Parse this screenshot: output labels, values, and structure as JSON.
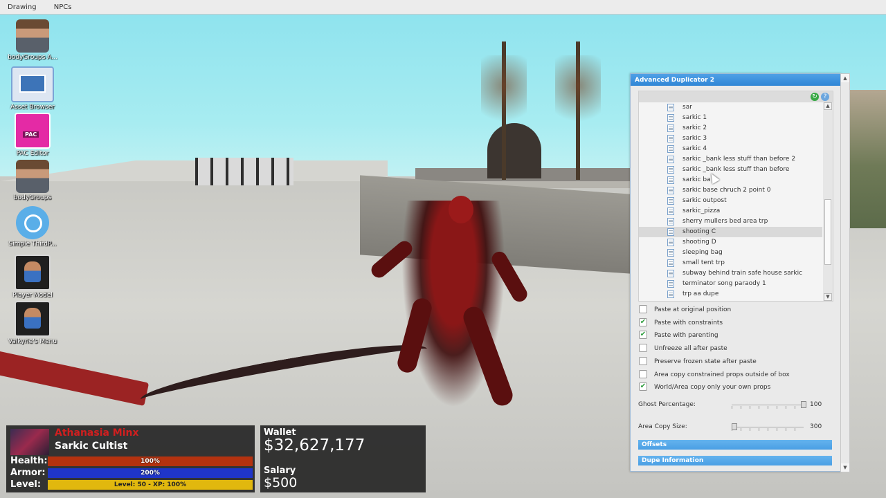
{
  "menu": [
    "Drawing",
    "NPCs"
  ],
  "desktop_icons": [
    {
      "label": "bodyGroups A...",
      "icon": "face-icon"
    },
    {
      "label": "Asset Browser",
      "icon": "asset-browser-icon"
    },
    {
      "label": "PAC Editor",
      "icon": "pac-icon"
    },
    {
      "label": "bodyGroups",
      "icon": "face-icon"
    },
    {
      "label": "Simple ThirdP...",
      "icon": "magnifier-icon"
    },
    {
      "label": "Player Model",
      "icon": "player-model-icon"
    },
    {
      "label": "Valkyrie's Menu",
      "icon": "player-model-icon"
    }
  ],
  "hud": {
    "name": "Athanasia Minx",
    "job": "Sarkic Cultist",
    "health_label": "Health:",
    "health_text": "100%",
    "health_fraction": 1.0,
    "armor_label": "Armor:",
    "armor_text": "200%",
    "armor_fraction": 1.0,
    "level_label": "Level:",
    "level_text": "Level: 50 - XP: 100%",
    "level_fraction": 1.0,
    "colors": {
      "health": "#b4320f",
      "armor": "#1f35c8",
      "level": "#e1b80e",
      "name": "#d11f1f"
    },
    "wallet_label": "Wallet",
    "wallet_value": "$32,627,177",
    "salary_label": "Salary",
    "salary_value": "$500"
  },
  "dupe_panel": {
    "title": "Advanced Duplicator 2",
    "files": [
      {
        "name": "sar",
        "selected": false
      },
      {
        "name": "sarkic 1",
        "selected": false
      },
      {
        "name": "sarkic 2",
        "selected": false
      },
      {
        "name": "sarkic 3",
        "selected": false
      },
      {
        "name": "sarkic 4",
        "selected": false
      },
      {
        "name": "sarkic _bank less stuff than before 2",
        "selected": false
      },
      {
        "name": "sarkic _bank less stuff than before",
        "selected": false
      },
      {
        "name": "sarkic ba",
        "selected": false
      },
      {
        "name": "sarkic base chruch 2 point 0",
        "selected": false
      },
      {
        "name": "sarkic outpost",
        "selected": false
      },
      {
        "name": "sarkic_pizza",
        "selected": false
      },
      {
        "name": "sherry mullers bed area trp",
        "selected": false
      },
      {
        "name": "shooting C",
        "selected": true
      },
      {
        "name": "shooting D",
        "selected": false
      },
      {
        "name": "sleeping bag",
        "selected": false
      },
      {
        "name": "small tent trp",
        "selected": false
      },
      {
        "name": "subway behind train safe house sarkic",
        "selected": false
      },
      {
        "name": "terminator song paraody 1",
        "selected": false
      },
      {
        "name": "trp aa dupe",
        "selected": false
      }
    ],
    "options": [
      {
        "label": "Paste at original position",
        "checked": false
      },
      {
        "label": "Paste with constraints",
        "checked": true
      },
      {
        "label": "Paste with parenting",
        "checked": true
      },
      {
        "label": "Unfreeze all after paste",
        "checked": false
      },
      {
        "label": "Preserve frozen state after paste",
        "checked": false
      },
      {
        "label": "Area copy constrained props outside of box",
        "checked": false
      },
      {
        "label": "World/Area copy only your own props",
        "checked": true
      }
    ],
    "ghost_label": "Ghost Percentage:",
    "ghost_value": "100",
    "ghost_fraction": 1.0,
    "area_label": "Area Copy Size:",
    "area_value": "300",
    "area_fraction": 0.0,
    "sections": [
      "Offsets",
      "Dupe Information"
    ]
  }
}
